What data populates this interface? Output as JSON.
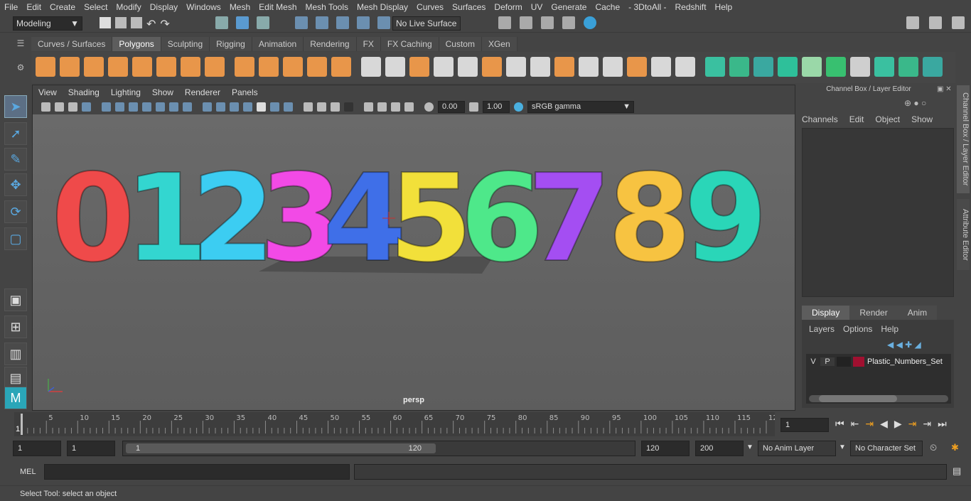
{
  "menubar": [
    "File",
    "Edit",
    "Create",
    "Select",
    "Modify",
    "Display",
    "Windows",
    "Mesh",
    "Edit Mesh",
    "Mesh Tools",
    "Mesh Display",
    "Curves",
    "Surfaces",
    "Deform",
    "UV",
    "Generate",
    "Cache",
    "- 3DtoAll -",
    "Redshift",
    "Help"
  ],
  "workspace": "Modeling",
  "live_surface": "No Live Surface",
  "shelf_tabs": [
    "Curves / Surfaces",
    "Polygons",
    "Sculpting",
    "Rigging",
    "Animation",
    "Rendering",
    "FX",
    "FX Caching",
    "Custom",
    "XGen"
  ],
  "active_shelf_tab": "Polygons",
  "viewport": {
    "menu": [
      "View",
      "Shading",
      "Lighting",
      "Show",
      "Renderer",
      "Panels"
    ],
    "exposure": "0.00",
    "gamma": "1.00",
    "color_space": "sRGB gamma",
    "camera": "persp"
  },
  "digits": [
    {
      "char": "0",
      "color": "#ef4a4a"
    },
    {
      "char": "1",
      "color": "#33d6d0"
    },
    {
      "char": "2",
      "color": "#3ccdf2"
    },
    {
      "char": "3",
      "color": "#f24ae6"
    },
    {
      "char": "4",
      "color": "#3f6fe8"
    },
    {
      "char": "5",
      "color": "#f2e03a"
    },
    {
      "char": "6",
      "color": "#4ee88a"
    },
    {
      "char": "7",
      "color": "#a44ef2"
    },
    {
      "char": "8",
      "color": "#f7c341"
    },
    {
      "char": "9",
      "color": "#2ad6b8"
    }
  ],
  "channel_box": {
    "title": "Channel Box / Layer Editor",
    "menu": [
      "Channels",
      "Edit",
      "Object",
      "Show"
    ]
  },
  "layer_editor": {
    "tabs": [
      "Display",
      "Render",
      "Anim"
    ],
    "menu": [
      "Layers",
      "Options",
      "Help"
    ],
    "layer": {
      "v": "V",
      "p": "P",
      "name": "Plastic_Numbers_Set",
      "color": "#a01030"
    }
  },
  "side_tabs": [
    "Channel Box / Layer Editor",
    "Attribute Editor"
  ],
  "timeline": {
    "ticks": [
      "5",
      "10",
      "15",
      "20",
      "25",
      "30",
      "35",
      "40",
      "45",
      "50",
      "55",
      "60",
      "65",
      "70",
      "75",
      "80",
      "85",
      "90",
      "95",
      "100",
      "105",
      "110",
      "115",
      "12"
    ],
    "start_label": "1",
    "current_frame": "1"
  },
  "range": {
    "start": "1",
    "playback_start": "1",
    "slider_start": "1",
    "slider_end": "120",
    "playback_end": "120",
    "end": "200",
    "anim_layer": "No Anim Layer",
    "character_set": "No Character Set"
  },
  "command": {
    "lang": "MEL"
  },
  "status": "Select Tool: select an object"
}
